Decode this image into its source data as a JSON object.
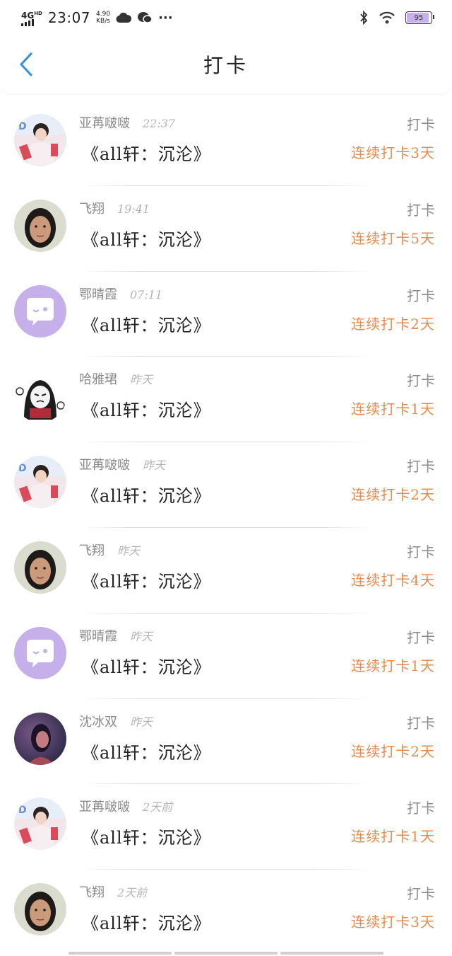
{
  "status_bar": {
    "network": "4G",
    "network_sup": "HD",
    "time": "23:07",
    "speed_value": "4.90",
    "speed_unit": "KB/s",
    "more": "···",
    "battery": "95"
  },
  "header": {
    "title": "打卡",
    "back_icon": "chevron-left-icon"
  },
  "colors": {
    "accent": "#2f8fe0",
    "streak": "#e88a4b",
    "muted": "#8a8a8a"
  },
  "items": [
    {
      "user": "亚苒啵啵",
      "time": "22:37",
      "book": "《all轩：沉沦》",
      "action": "打卡",
      "streak": "连续打卡3天",
      "avatar": "photo-red"
    },
    {
      "user": "飞翔",
      "time": "19:41",
      "book": "《all轩：沉沦》",
      "action": "打卡",
      "streak": "连续打卡5天",
      "avatar": "photo-face"
    },
    {
      "user": "鄂晴霞",
      "time": "07:11",
      "book": "《all轩：沉沦》",
      "action": "打卡",
      "streak": "连续打卡2天",
      "avatar": "default-purple"
    },
    {
      "user": "哈雅珺",
      "time": "昨天",
      "book": "《all轩：沉沦》",
      "action": "打卡",
      "streak": "连续打卡1天",
      "avatar": "cartoon"
    },
    {
      "user": "亚苒啵啵",
      "time": "昨天",
      "book": "《all轩：沉沦》",
      "action": "打卡",
      "streak": "连续打卡2天",
      "avatar": "photo-red"
    },
    {
      "user": "飞翔",
      "time": "昨天",
      "book": "《all轩：沉沦》",
      "action": "打卡",
      "streak": "连续打卡4天",
      "avatar": "photo-face"
    },
    {
      "user": "鄂晴霞",
      "time": "昨天",
      "book": "《all轩：沉沦》",
      "action": "打卡",
      "streak": "连续打卡1天",
      "avatar": "default-purple"
    },
    {
      "user": "沈冰双",
      "time": "昨天",
      "book": "《all轩：沉沦》",
      "action": "打卡",
      "streak": "连续打卡2天",
      "avatar": "photo-dark"
    },
    {
      "user": "亚苒啵啵",
      "time": "2天前",
      "book": "《all轩：沉沦》",
      "action": "打卡",
      "streak": "连续打卡1天",
      "avatar": "photo-red"
    },
    {
      "user": "飞翔",
      "time": "2天前",
      "book": "《all轩：沉沦》",
      "action": "打卡",
      "streak": "连续打卡3天",
      "avatar": "photo-face"
    }
  ]
}
